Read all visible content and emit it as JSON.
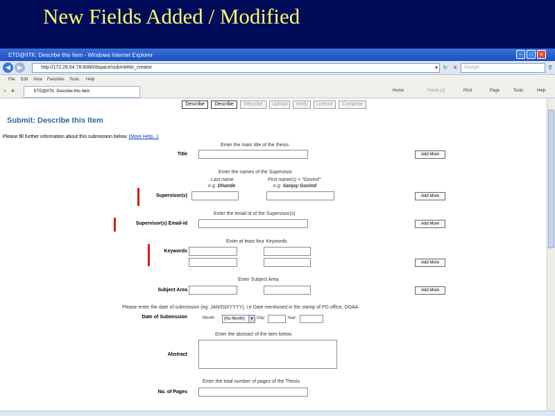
{
  "slide": {
    "title": "New Fields Added / Modified"
  },
  "browser": {
    "window_title": "ETD@IITK: Describe this Item - Windows Internet Explorer",
    "url": "http://172.28.64.78:8080/dspace/submit#dc_creator",
    "search_placeholder": "Google",
    "menu": [
      "File",
      "Edit",
      "View",
      "Favorites",
      "Tools",
      "Help"
    ],
    "tab_label": "ETD@IITK: Describe this Item",
    "toolbar": {
      "home": "Home",
      "feeds": "Feeds (J)",
      "print": "Print",
      "page": "Page",
      "tools": "Tools",
      "help": "Help"
    }
  },
  "steps": [
    "Describe",
    "Describe",
    "Describe",
    "Upload",
    "Verify",
    "License",
    "Complete"
  ],
  "form": {
    "heading": "Submit: Describe this Item",
    "intro": "Please fill further information about this submission below.",
    "more_help": "(More Help...)",
    "add_more": "Add More",
    "title": {
      "hint": "Enter the main title of the thesis.",
      "label": "Title"
    },
    "supervisor": {
      "hint": "Enter the names of the Supervisor",
      "last_name": "Last name",
      "first_name": "First name(s) + \"Govind\"",
      "eg_last_prefix": "e.g.",
      "eg_last": "Dhande",
      "eg_first_prefix": "e.g.",
      "eg_first": "Sanjay Govind",
      "label": "Supervisor(s)"
    },
    "supervisor_email": {
      "hint": "Enter the email id of the Supervisor(s)",
      "label": "Supervisor(s) Email-id"
    },
    "keywords": {
      "hint": "Enter at least four Keywords",
      "label": "Keywords"
    },
    "subject_area": {
      "hint": "Enter Subject Area",
      "label": "Subject Area"
    },
    "date": {
      "hint": "Please enter the date of submission (eg. JAN/DD/YYYY), i.e Date mentioned in the stamp of PG office, DOAA.",
      "label": "Date of Submission",
      "month_label": "Month:",
      "month_value": "(No Month)",
      "day_label": "Day:",
      "year_label": "Year:"
    },
    "abstract": {
      "hint": "Enter the abstract of the item below.",
      "label": "Abstract"
    },
    "pages": {
      "hint": "Enter the total number of pages of the Thesis.",
      "label": "No. of Pages"
    }
  }
}
